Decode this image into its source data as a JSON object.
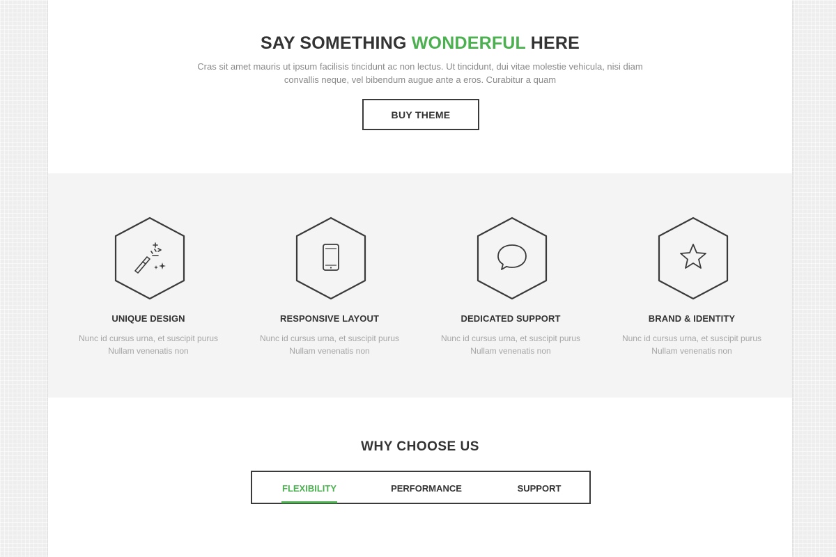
{
  "hero": {
    "title_before": "SAY SOMETHING ",
    "title_accent": "WONDERFUL",
    "title_after": " HERE",
    "text": "Cras sit amet mauris ut ipsum facilisis tincidunt ac non lectus. Ut tincidunt, dui vitae molestie vehicula, nisi diam convallis neque, vel bibendum augue ante a eros. Curabitur a quam",
    "button_label": "BUY THEME"
  },
  "features": [
    {
      "icon": "magic-wand-icon",
      "title": "UNIQUE DESIGN",
      "text": "Nunc id cursus urna, et suscipit purus Nullam venenatis non"
    },
    {
      "icon": "smartphone-icon",
      "title": "RESPONSIVE LAYOUT",
      "text": "Nunc id cursus urna, et suscipit purus Nullam venenatis non"
    },
    {
      "icon": "chat-bubble-icon",
      "title": "DEDICATED SUPPORT",
      "text": "Nunc id cursus urna, et suscipit purus Nullam venenatis non"
    },
    {
      "icon": "star-icon",
      "title": "BRAND & IDENTITY",
      "text": "Nunc id cursus urna, et suscipit purus Nullam venenatis non"
    }
  ],
  "why": {
    "title": "WHY CHOOSE US",
    "tabs": [
      {
        "label": "FLEXIBILITY",
        "active": true
      },
      {
        "label": "PERFORMANCE",
        "active": false
      },
      {
        "label": "SUPPORT",
        "active": false
      }
    ]
  },
  "colors": {
    "accent": "#4caf50",
    "text_dark": "#333333",
    "text_muted": "#8a8a8a",
    "section_bg": "#f4f4f4",
    "page_bg": "#eeeeee"
  }
}
